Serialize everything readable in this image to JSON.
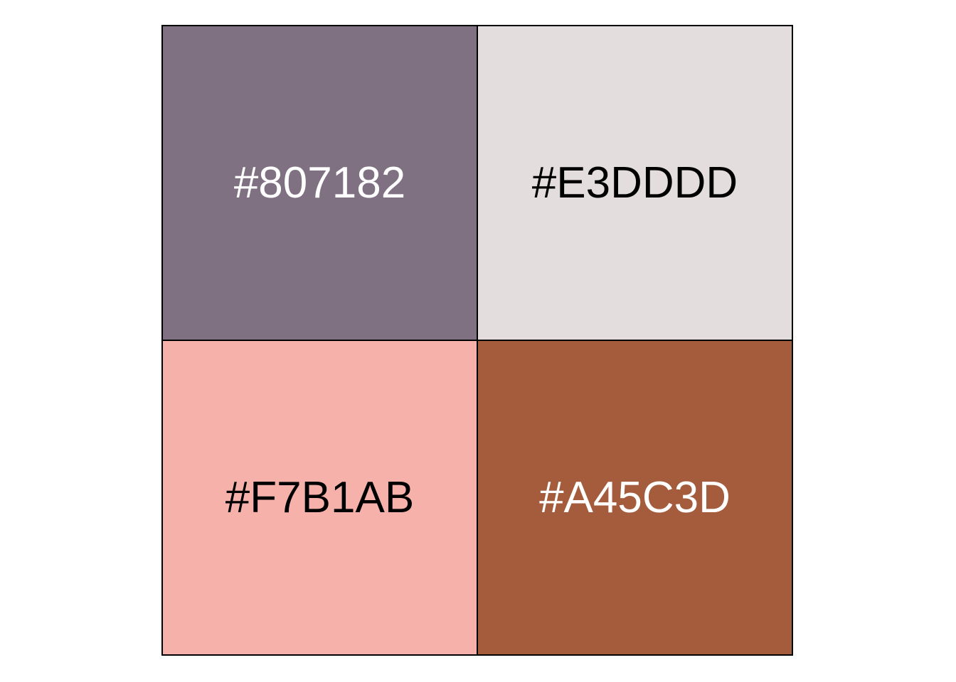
{
  "swatches": [
    {
      "label": "#807182",
      "color": "#807182",
      "text_color": "#FFFFFF"
    },
    {
      "label": "#E3DDDD",
      "color": "#E3DDDD",
      "text_color": "#000000"
    },
    {
      "label": "#F7B1AB",
      "color": "#F7B1AB",
      "text_color": "#000000"
    },
    {
      "label": "#A45C3D",
      "color": "#A45C3D",
      "text_color": "#FFFFFF"
    }
  ]
}
